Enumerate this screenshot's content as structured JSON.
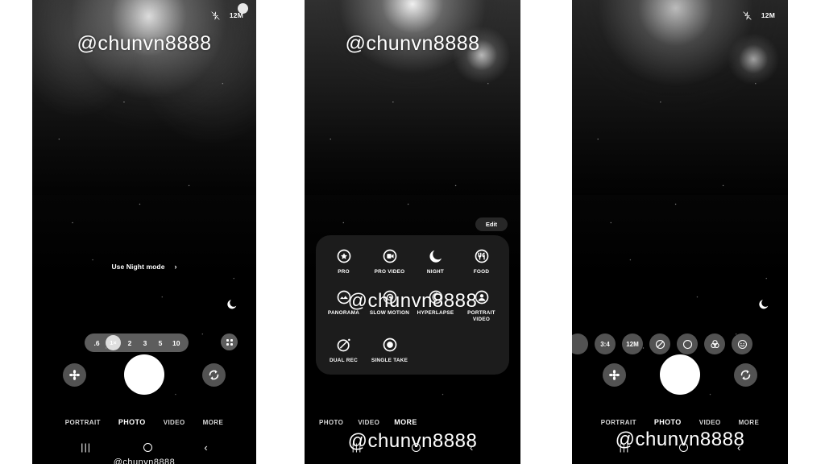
{
  "watermark": {
    "handle": "@chunvn8888"
  },
  "status": {
    "flash_icon": "flash-off-icon",
    "resolution": "12M"
  },
  "phone1": {
    "night_suggestion": {
      "label": "Use Night mode",
      "chevron": "›"
    },
    "moon_icon": "moon-icon",
    "zoom_levels": [
      {
        "label": ".6",
        "selected": false
      },
      {
        "label": "1×",
        "selected": true
      },
      {
        "label": "2",
        "selected": false
      },
      {
        "label": "3",
        "selected": false
      },
      {
        "label": "5",
        "selected": false
      },
      {
        "label": "10",
        "selected": false
      }
    ],
    "grid_button_icon": "grid-icon",
    "gallery_button_icon": "gallery-flower-icon",
    "shutter_button_icon": "shutter-icon",
    "switch_camera_icon": "switch-camera-icon",
    "modes": [
      {
        "label": "PORTRAIT",
        "active": false
      },
      {
        "label": "PHOTO",
        "active": true
      },
      {
        "label": "VIDEO",
        "active": false
      },
      {
        "label": "MORE",
        "active": false
      }
    ]
  },
  "phone2": {
    "edit_button": "Edit",
    "mode_panel": [
      {
        "label": "PRO",
        "icon": "pro-icon"
      },
      {
        "label": "PRO VIDEO",
        "icon": "pro-video-icon"
      },
      {
        "label": "NIGHT",
        "icon": "night-icon"
      },
      {
        "label": "FOOD",
        "icon": "food-icon"
      },
      {
        "label": "PANORAMA",
        "icon": "panorama-icon"
      },
      {
        "label": "SLOW MOTION",
        "icon": "slow-motion-icon"
      },
      {
        "label": "HYPERLAPSE",
        "icon": "hyperlapse-icon"
      },
      {
        "label": "PORTRAIT VIDEO",
        "icon": "portrait-video-icon"
      },
      {
        "label": "DUAL REC",
        "icon": "dual-rec-icon"
      },
      {
        "label": "SINGLE TAKE",
        "icon": "single-take-icon"
      }
    ],
    "modes": [
      {
        "label": "PHOTO",
        "active": false
      },
      {
        "label": "VIDEO",
        "active": false
      },
      {
        "label": "MORE",
        "active": true
      }
    ]
  },
  "phone3": {
    "moon_icon": "moon-icon",
    "settings": [
      {
        "label": "",
        "icon": "partial-icon"
      },
      {
        "label": "3:4",
        "icon": "aspect-ratio-icon"
      },
      {
        "label": "12M",
        "icon": "resolution-icon"
      },
      {
        "label": "",
        "icon": "timer-off-icon"
      },
      {
        "label": "",
        "icon": "motion-photo-icon"
      },
      {
        "label": "",
        "icon": "color-filter-icon"
      },
      {
        "label": "",
        "icon": "face-effect-icon"
      }
    ],
    "gallery_button_icon": "gallery-flower-icon",
    "shutter_button_icon": "shutter-icon",
    "switch_camera_icon": "switch-camera-icon",
    "modes": [
      {
        "label": "PORTRAIT",
        "active": false
      },
      {
        "label": "PHOTO",
        "active": true
      },
      {
        "label": "VIDEO",
        "active": false
      },
      {
        "label": "MORE",
        "active": false
      }
    ]
  },
  "navbar": {
    "recents": "|||",
    "home": "home-icon",
    "back": "‹"
  }
}
